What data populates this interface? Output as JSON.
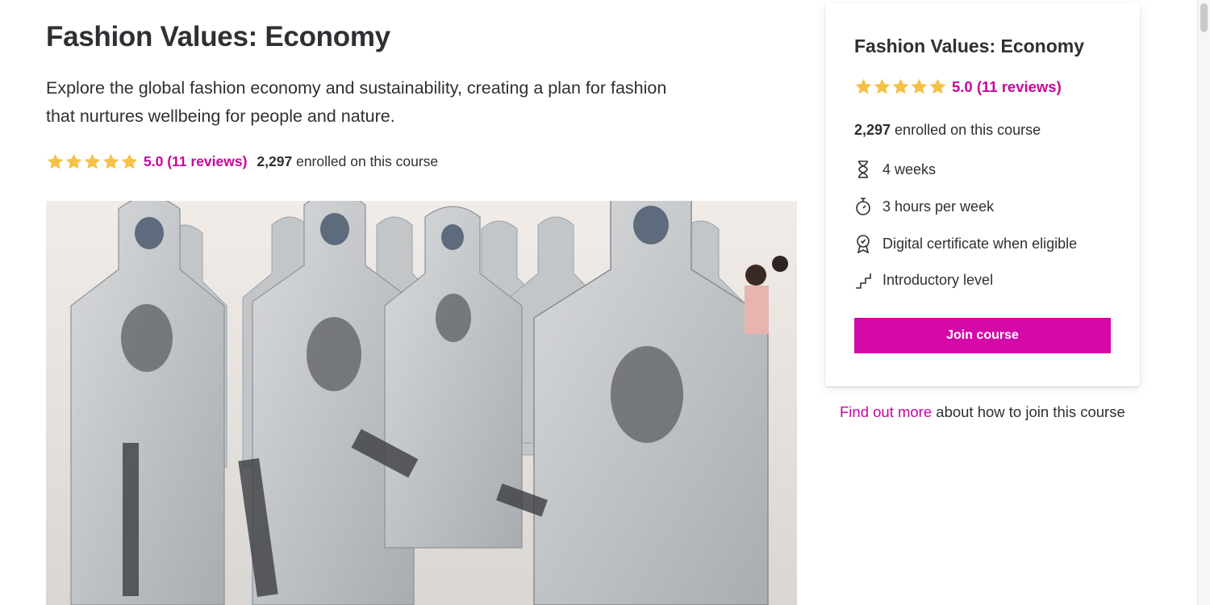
{
  "course": {
    "title": "Fashion Values: Economy",
    "description_line1": "Explore the global fashion economy and sustainability, creating a plan for fashion",
    "description_line2": "that nurtures wellbeing for people and nature.",
    "rating_text": "5.0 (11 reviews)",
    "rating_value": 5.0,
    "stars_filled": 5,
    "enrolled_count": "2,297",
    "enrolled_suffix": " enrolled on this course"
  },
  "hero_image": {
    "icon": "photo-hooded-garments-exhibition"
  },
  "card": {
    "title": "Fashion Values: Economy",
    "rating_text": "5.0 (11 reviews)",
    "enrolled_count": "2,297",
    "enrolled_suffix": " enrolled on this course",
    "details": [
      {
        "icon": "hourglass-icon",
        "label": "4 weeks"
      },
      {
        "icon": "stopwatch-icon",
        "label": "3 hours per week"
      },
      {
        "icon": "certificate-icon",
        "label": "Digital certificate when eligible"
      },
      {
        "icon": "steps-icon",
        "label": "Introductory level"
      }
    ],
    "join_label": "Join course"
  },
  "find_more": {
    "link_text": "Find out more",
    "rest_text": " about how to join this course"
  },
  "colors": {
    "accent": "#d508a8",
    "link": "#c6069f",
    "star": "#f5c147",
    "text": "#2f2f34"
  }
}
